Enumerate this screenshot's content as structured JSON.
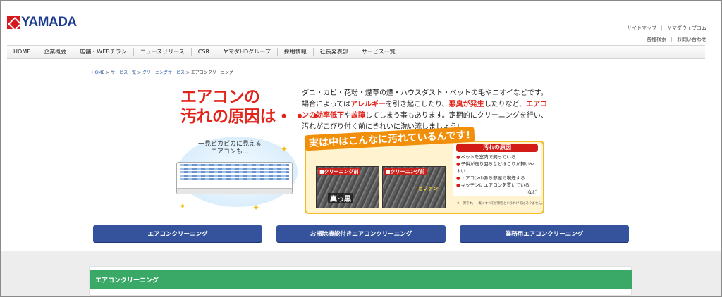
{
  "header": {
    "logo_text": "YAMADA",
    "util_links_row1": [
      "サイトマップ",
      "ヤマダウェブコム"
    ],
    "util_links_row2": [
      "各種検索",
      "お問い合わせ"
    ]
  },
  "nav": {
    "items": [
      "HOME",
      "企業概要",
      "店舗・WEBチラシ",
      "ニュースリリース",
      "CSR",
      "ヤマダHDグループ",
      "採用情報",
      "社長発表部",
      "サービス一覧"
    ]
  },
  "breadcrumb": {
    "items": [
      "HOME",
      "サービス一覧",
      "クリーニングサービス",
      "エアコンクリーニング"
    ],
    "sep": ">"
  },
  "hero": {
    "title_line1": "エアコンの",
    "title_line2": "汚れの原因は・・・",
    "text_plain1": "ダニ・カビ・花粉・煙草の煙・ハウスダスト・ペットの毛やニオイなどです。場合によっては",
    "text_red1": "アレルギー",
    "text_plain2": "を引き起こしたり、",
    "text_red2": "悪臭が発生",
    "text_plain3": "したりなど、",
    "text_red3": "エアコンの効率低下",
    "text_plain4": "や",
    "text_red4": "故障",
    "text_plain5": "してしまう事もあります。定期的にクリーニングを行い、汚れがこびり付く前にきれいに洗い流しましょう!",
    "bubble_line1": "一見ピカピカに見える",
    "bubble_line2": "エアコンも…",
    "callout_heading": "実は中はこんなに汚れているんです!",
    "photo1_label": "■クリーニング前",
    "photo1_tag": "真っ黒",
    "photo2_label": "■クリーニング前",
    "photo2_tag": "ヒファン",
    "causes_title": "汚れの原因",
    "causes": [
      "ペットを室内で飼っている",
      "子供が走り回るなどほこりが舞いやすい",
      "エアコンのある部屋で喫煙する",
      "キッチンにエアコンを置いている",
      "など"
    ],
    "note": "※一例です。一概にすべてが原因というわけではありません。"
  },
  "buttons": [
    "エアコンクリーニング",
    "お掃除機能付きエアコンクリーニング",
    "業務用エアコンクリーニング"
  ],
  "section": {
    "heading": "エアコンクリーニング"
  },
  "colors": {
    "brand_blue": "#1b3c8e",
    "button_blue": "#34539c",
    "accent_red": "#e2231a",
    "section_green": "#3aa866"
  }
}
